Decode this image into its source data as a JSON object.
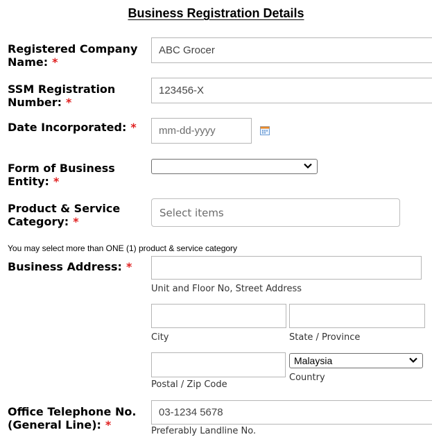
{
  "page_title": "Business Registration Details",
  "required_marker": "*",
  "accent_colors": {
    "required": "#e02020",
    "border": "#b5b5b5"
  },
  "fields": {
    "company_name": {
      "label_line1": "Registered Company",
      "label_line2": "Name:",
      "value": "ABC Grocer"
    },
    "ssm_number": {
      "label_line1": "SSM Registration",
      "label_line2": "Number:",
      "value": "123456-X"
    },
    "date_incorporated": {
      "label": "Date Incorporated:",
      "placeholder": "mm-dd-yyyy",
      "icon": "calendar-icon"
    },
    "business_entity": {
      "label_line1": "Form of Business",
      "label_line2": "Entity:",
      "value": ""
    },
    "category": {
      "label_line1": "Product & Service",
      "label_line2": "Category:",
      "placeholder": "Select items",
      "note": "You may select more than ONE (1) product & service category"
    },
    "address": {
      "label": "Business Address:",
      "street_caption": "Unit and Floor No, Street Address",
      "city_caption": "City",
      "state_caption": "State / Province",
      "postal_caption": "Postal / Zip Code",
      "country_value": "Malaysia",
      "country_caption": "Country"
    },
    "telephone": {
      "label_line1": "Office Telephone No.",
      "label_line2": "(General Line):",
      "value": "03-1234 5678",
      "caption": "Preferably Landline No."
    }
  }
}
